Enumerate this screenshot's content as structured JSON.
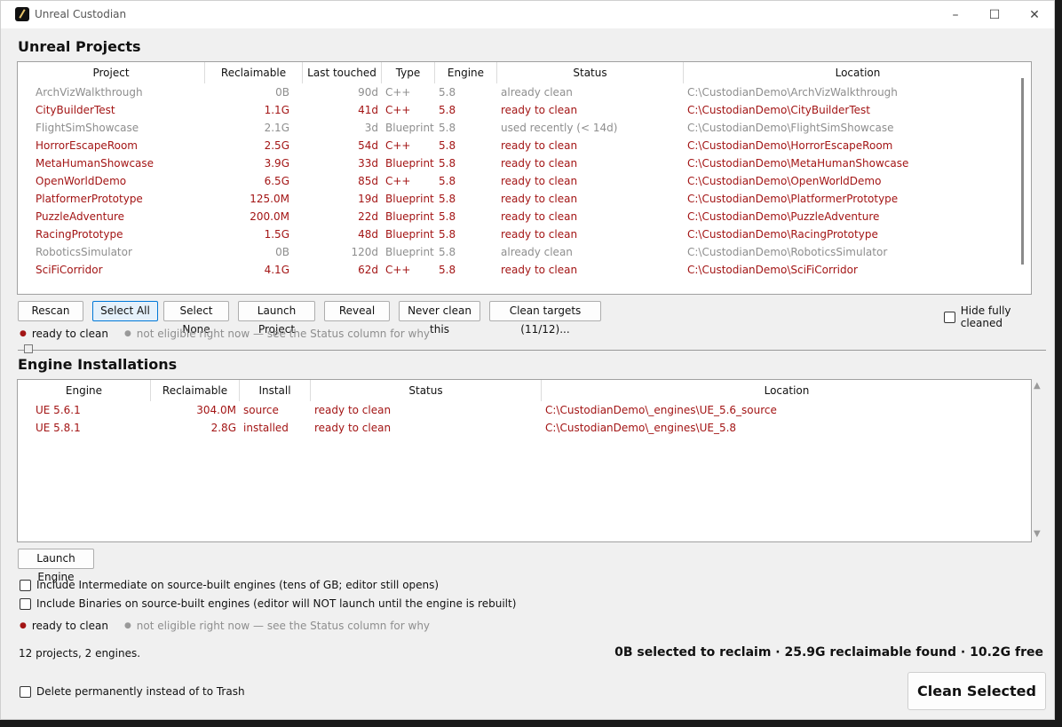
{
  "window": {
    "title": "Unreal Custodian"
  },
  "projects": {
    "section_title": "Unreal Projects",
    "columns": [
      "Project",
      "Reclaimable",
      "Last touched",
      "Type",
      "Engine",
      "Status",
      "Location"
    ],
    "rows": [
      {
        "name": "ArchVizWalkthrough",
        "reclaimable": "0B",
        "last": "90d",
        "type": "C++",
        "engine": "5.8",
        "status": "already clean",
        "location": "C:\\CustodianDemo\\ArchVizWalkthrough",
        "state": "clean"
      },
      {
        "name": "CityBuilderTest",
        "reclaimable": "1.1G",
        "last": "41d",
        "type": "C++",
        "engine": "5.8",
        "status": "ready to clean",
        "location": "C:\\CustodianDemo\\CityBuilderTest",
        "state": "ready"
      },
      {
        "name": "FlightSimShowcase",
        "reclaimable": "2.1G",
        "last": "3d",
        "type": "Blueprint",
        "engine": "5.8",
        "status": "used recently (< 14d)",
        "location": "C:\\CustodianDemo\\FlightSimShowcase",
        "state": "clean"
      },
      {
        "name": "HorrorEscapeRoom",
        "reclaimable": "2.5G",
        "last": "54d",
        "type": "C++",
        "engine": "5.8",
        "status": "ready to clean",
        "location": "C:\\CustodianDemo\\HorrorEscapeRoom",
        "state": "ready"
      },
      {
        "name": "MetaHumanShowcase",
        "reclaimable": "3.9G",
        "last": "33d",
        "type": "Blueprint",
        "engine": "5.8",
        "status": "ready to clean",
        "location": "C:\\CustodianDemo\\MetaHumanShowcase",
        "state": "ready"
      },
      {
        "name": "OpenWorldDemo",
        "reclaimable": "6.5G",
        "last": "85d",
        "type": "C++",
        "engine": "5.8",
        "status": "ready to clean",
        "location": "C:\\CustodianDemo\\OpenWorldDemo",
        "state": "ready"
      },
      {
        "name": "PlatformerPrototype",
        "reclaimable": "125.0M",
        "last": "19d",
        "type": "Blueprint",
        "engine": "5.8",
        "status": "ready to clean",
        "location": "C:\\CustodianDemo\\PlatformerPrototype",
        "state": "ready"
      },
      {
        "name": "PuzzleAdventure",
        "reclaimable": "200.0M",
        "last": "22d",
        "type": "Blueprint",
        "engine": "5.8",
        "status": "ready to clean",
        "location": "C:\\CustodianDemo\\PuzzleAdventure",
        "state": "ready"
      },
      {
        "name": "RacingPrototype",
        "reclaimable": "1.5G",
        "last": "48d",
        "type": "Blueprint",
        "engine": "5.8",
        "status": "ready to clean",
        "location": "C:\\CustodianDemo\\RacingPrototype",
        "state": "ready"
      },
      {
        "name": "RoboticsSimulator",
        "reclaimable": "0B",
        "last": "120d",
        "type": "Blueprint",
        "engine": "5.8",
        "status": "already clean",
        "location": "C:\\CustodianDemo\\RoboticsSimulator",
        "state": "clean"
      },
      {
        "name": "SciFiCorridor",
        "reclaimable": "4.1G",
        "last": "62d",
        "type": "C++",
        "engine": "5.8",
        "status": "ready to clean",
        "location": "C:\\CustodianDemo\\SciFiCorridor",
        "state": "ready"
      }
    ],
    "buttons": {
      "rescan": "Rescan",
      "select_all": "Select All",
      "select_none": "Select None",
      "launch_project": "Launch Project",
      "reveal": "Reveal",
      "never_clean": "Never clean this",
      "clean_targets": "Clean targets (11/12)..."
    },
    "hide_cleaned": "Hide fully cleaned"
  },
  "legend": {
    "bullet": "●",
    "ready": "ready to clean",
    "not_eligible": "not eligible right now — see the Status column for why"
  },
  "engines": {
    "section_title": "Engine Installations",
    "columns": [
      "Engine",
      "Reclaimable",
      "Install",
      "Status",
      "Location"
    ],
    "rows": [
      {
        "name": "UE 5.6.1",
        "reclaimable": "304.0M",
        "install": "source",
        "status": "ready to clean",
        "location": "C:\\CustodianDemo\\_engines\\UE_5.6_source",
        "state": "ready"
      },
      {
        "name": "UE 5.8.1",
        "reclaimable": "2.8G",
        "install": "installed",
        "status": "ready to clean",
        "location": "C:\\CustodianDemo\\_engines\\UE_5.8",
        "state": "ready"
      }
    ],
    "launch_engine": "Launch Engine",
    "include_intermediate": "Include Intermediate on source-built engines (tens of GB; editor still opens)",
    "include_binaries": "Include Binaries on source-built engines (editor will NOT launch until the engine is rebuilt)"
  },
  "footer": {
    "summary": "12 projects, 2 engines.",
    "totals": "0B selected to reclaim  ·  25.9G reclaimable found  ·  10.2G free",
    "delete_permanently": "Delete permanently instead of to Trash",
    "clean_selected": "Clean Selected"
  },
  "colors": {
    "ready": "#a31515",
    "not_eligible": "#8e8e8e",
    "accent": "#0078d7"
  }
}
